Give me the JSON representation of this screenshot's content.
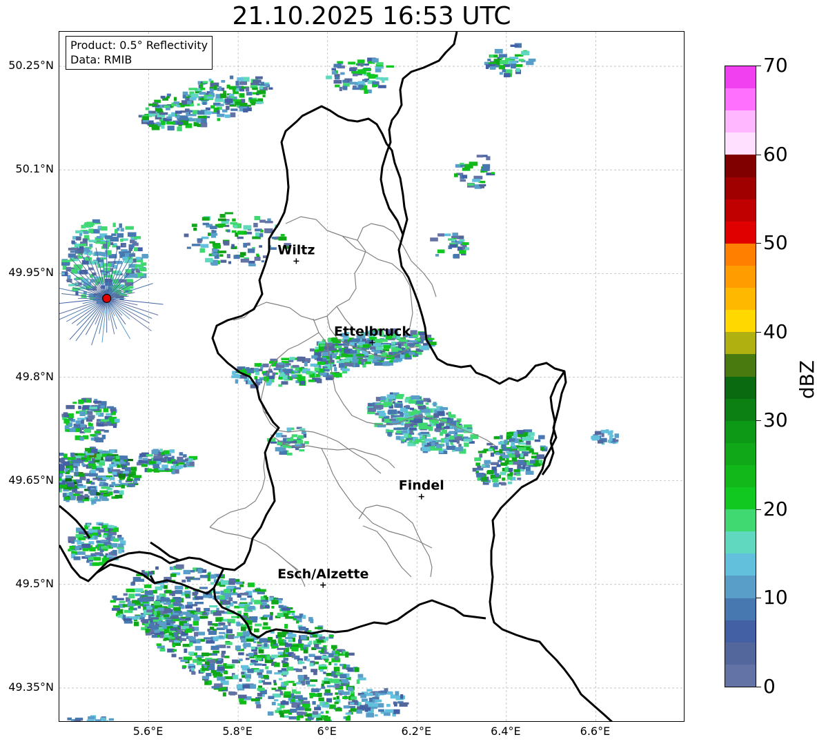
{
  "title": "21.10.2025 16:53 UTC",
  "info_box": {
    "product": "Product: 0.5° Reflectivity",
    "data": "Data: RMIB"
  },
  "map": {
    "lon_range": [
      5.4,
      6.8
    ],
    "lat_range": [
      49.3,
      50.3
    ],
    "lat_ticks": [
      {
        "value": 49.35,
        "label": "49.35°N"
      },
      {
        "value": 49.5,
        "label": "49.5°N"
      },
      {
        "value": 49.65,
        "label": "49.65°N"
      },
      {
        "value": 49.8,
        "label": "49.8°N"
      },
      {
        "value": 49.95,
        "label": "49.95°N"
      },
      {
        "value": 50.1,
        "label": "50.1°N"
      },
      {
        "value": 50.25,
        "label": "50.25°N"
      }
    ],
    "lon_ticks": [
      {
        "value": 5.6,
        "label": "5.6°E"
      },
      {
        "value": 5.8,
        "label": "5.8°E"
      },
      {
        "value": 6.0,
        "label": "6°E"
      },
      {
        "value": 6.2,
        "label": "6.2°E"
      },
      {
        "value": 6.4,
        "label": "6.4°E"
      },
      {
        "value": 6.6,
        "label": "6.6°E"
      }
    ],
    "gridlines": true,
    "cities": [
      {
        "name": "Wiltz",
        "lon": 5.93,
        "lat": 49.968
      },
      {
        "name": "Ettelbruck",
        "lon": 6.1,
        "lat": 49.85
      },
      {
        "name": "Findel",
        "lon": 6.21,
        "lat": 49.627
      },
      {
        "name": "Esch/Alzette",
        "lon": 5.99,
        "lat": 49.499
      }
    ],
    "radar_site": {
      "lon": 5.506,
      "lat": 49.914
    },
    "boundary_color": "#000000",
    "canton_color": "#808080"
  },
  "colorbar": {
    "label": "dBZ",
    "min": 0,
    "max": 70,
    "ticks": [
      "0",
      "10",
      "20",
      "30",
      "40",
      "50",
      "60",
      "70"
    ],
    "colors": [
      "#6373a6",
      "#53679c",
      "#4360a4",
      "#4878b0",
      "#589ec8",
      "#63c0dc",
      "#60d8c0",
      "#40d870",
      "#10c820",
      "#12b81a",
      "#10a818",
      "#0d9815",
      "#0c8012",
      "#0a6a10",
      "#487a10",
      "#b0b010",
      "#ffd800",
      "#ffb800",
      "#ff9c00",
      "#ff8000",
      "#e00000",
      "#c00000",
      "#a00000",
      "#800000",
      "#ffe0ff",
      "#ffb8ff",
      "#ff70ff",
      "#f040f0"
    ]
  }
}
